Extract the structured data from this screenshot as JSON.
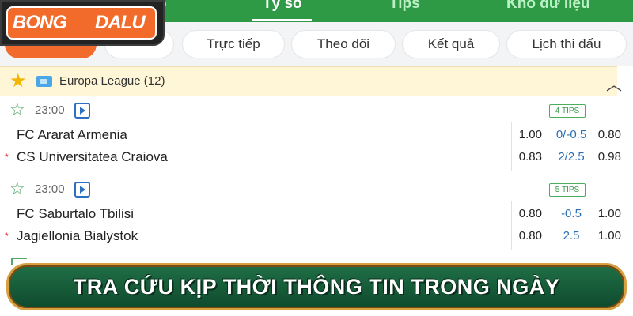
{
  "topnav": {
    "tabs": [
      {
        "label": "6",
        "active": false
      },
      {
        "label": "Tỷ số",
        "active": true
      },
      {
        "label": "Tips",
        "active": false
      },
      {
        "label": "Kho dữ liệu",
        "active": false
      }
    ]
  },
  "filters": {
    "chips": [
      "Trực tiếp",
      "Theo dõi",
      "Kết quả",
      "Lịch thi đấu"
    ]
  },
  "league": {
    "name": "Europa League (12)",
    "icons": [
      "star-icon",
      "flag-icon",
      "chevron-up-icon"
    ]
  },
  "matches": [
    {
      "time": "23:00",
      "tips": "4 TIPS",
      "home": "FC Ararat Armenia",
      "away": "CS Universitatea Craiova",
      "odds_row1": [
        "1.00",
        "0/-0.5",
        "0.80"
      ],
      "odds_row2": [
        "0.83",
        "2/2.5",
        "0.98"
      ]
    },
    {
      "time": "23:00",
      "tips": "5 TIPS",
      "home": "FC Saburtalo Tbilisi",
      "away": "Jagiellonia Bialystok",
      "odds_row1": [
        "0.80",
        "-0.5",
        "1.00"
      ],
      "odds_row2": [
        "0.80",
        "2.5",
        "1.00"
      ]
    }
  ],
  "logo": {
    "part1": "BONG",
    "part2": "DALU"
  },
  "banner": {
    "text": "TRA CỨU KỊP THỜI THÔNG TIN TRONG NGÀY"
  },
  "colors": {
    "nav": "#2e9a46",
    "accent": "#f26a2c",
    "banner": "#1f6f46",
    "odds_blue": "#2a6fb5"
  }
}
